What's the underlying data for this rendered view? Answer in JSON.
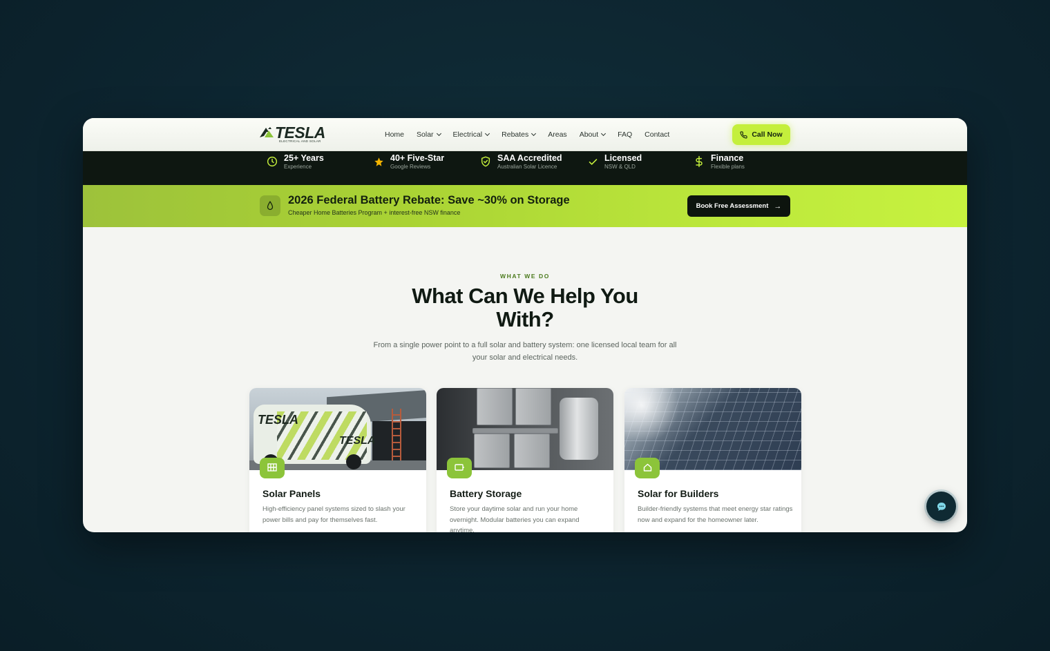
{
  "brand": {
    "name": "TESLA",
    "tagline": "ELECTRICAL AND SOLAR",
    "accent": "#c4ef3c",
    "dark": "#0e1711"
  },
  "nav": {
    "items": [
      {
        "label": "Home",
        "has_dropdown": false
      },
      {
        "label": "Solar",
        "has_dropdown": true
      },
      {
        "label": "Electrical",
        "has_dropdown": true
      },
      {
        "label": "Rebates",
        "has_dropdown": true
      },
      {
        "label": "Areas",
        "has_dropdown": false
      },
      {
        "label": "About",
        "has_dropdown": true
      },
      {
        "label": "FAQ",
        "has_dropdown": false
      },
      {
        "label": "Contact",
        "has_dropdown": false
      }
    ],
    "cta_label": "Call Now",
    "cta_icon": "phone-icon"
  },
  "trust": [
    {
      "title": "25+ Years",
      "sub": "Experience",
      "icon": "clock-icon"
    },
    {
      "title": "40+ Five-Star",
      "sub": "Google Reviews",
      "icon": "star-icon"
    },
    {
      "title": "SAA Accredited",
      "sub": "Australian Solar Licence",
      "icon": "shield-check-icon"
    },
    {
      "title": "Licensed",
      "sub": "NSW & QLD",
      "icon": "check-icon"
    },
    {
      "title": "Finance",
      "sub": "Flexible plans",
      "icon": "dollar-icon"
    }
  ],
  "promo": {
    "icon": "drop-icon",
    "title": "2026 Federal Battery Rebate: Save ~30% on Storage",
    "subtitle": "Cheaper Home Batteries Program + interest-free NSW finance",
    "button_label": "Book Free Assessment",
    "button_arrow": "→"
  },
  "services": {
    "eyebrow": "WHAT WE DO",
    "heading": "What Can We Help You With?",
    "lead": "From a single power point to a full solar and battery system: one licensed local team for all your solar and electrical needs.",
    "cards": [
      {
        "title": "Solar Panels",
        "desc": "High-efficiency panel systems sized to slash your power bills and pay for themselves fast.",
        "badge_icon": "grid-icon",
        "van_logo": "TESLA"
      },
      {
        "title": "Battery Storage",
        "desc": "Store your daytime solar and run your home overnight. Modular batteries you can expand anytime.",
        "badge_icon": "battery-icon"
      },
      {
        "title": "Solar for Builders",
        "desc": "Builder-friendly systems that meet energy star ratings now and expand for the homeowner later.",
        "badge_icon": "house-icon"
      }
    ]
  },
  "chat": {
    "icon": "chat-bubble-icon"
  }
}
